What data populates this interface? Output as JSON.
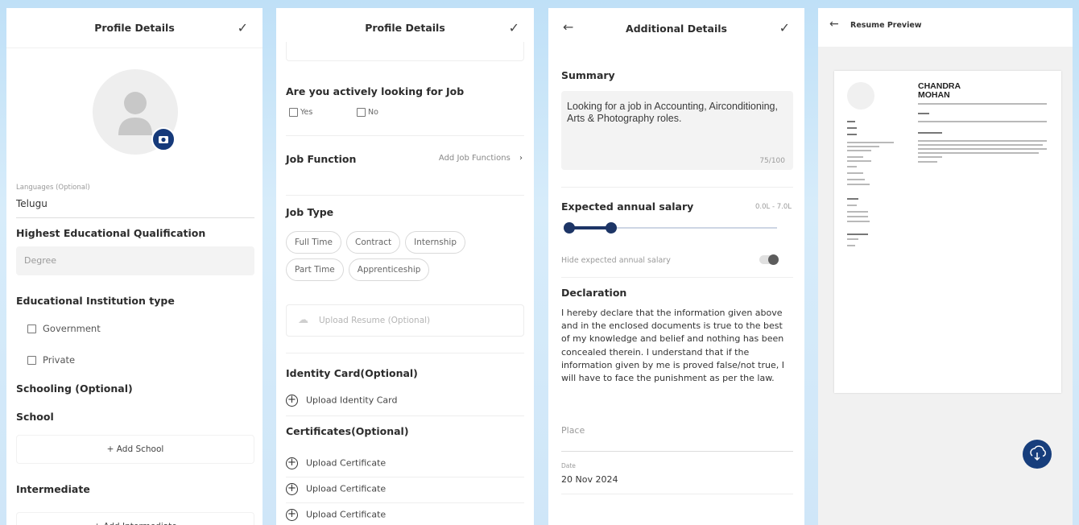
{
  "screen1": {
    "title": "Profile Details",
    "languages_label": "Languages (Optional)",
    "languages_value": "Telugu",
    "qualification_heading": "Highest Educational Qualification",
    "qualification_value": "Degree",
    "institution_heading": "Educational Institution type",
    "institution_options": [
      "Government",
      "Private"
    ],
    "schooling_heading": "Schooling (Optional)",
    "school_heading": "School",
    "add_school": "+ Add School",
    "intermediate_heading": "Intermediate",
    "add_intermediate": "+ Add Intermediate"
  },
  "screen2": {
    "title": "Profile Details",
    "looking_heading": "Are you actively looking for Job",
    "looking_options": [
      "Yes",
      "No"
    ],
    "job_function_heading": "Job Function",
    "job_function_link": "Add Job Functions",
    "job_type_heading": "Job Type",
    "job_types": [
      "Full Time",
      "Contract",
      "Internship",
      "Part Time",
      "Apprenticeship"
    ],
    "upload_resume": "Upload Resume (Optional)",
    "identity_heading": "Identity Card(Optional)",
    "upload_identity": "Upload Identity Card",
    "certificates_heading": "Certificates(Optional)",
    "upload_certificates": [
      "Upload Certificate",
      "Upload Certificate",
      "Upload Certificate"
    ]
  },
  "screen3": {
    "title": "Additional Details",
    "summary_heading": "Summary",
    "summary_text": "Looking for a job in Accounting, Airconditioning, Arts & Photography roles.",
    "summary_count": "75/100",
    "salary_heading": "Expected annual salary",
    "salary_range": "0.0L - 7.0L",
    "salary_slider": {
      "min_fraction": 0.0,
      "max_fraction": 0.2
    },
    "hide_salary_label": "Hide expected annual salary",
    "declaration_heading": "Declaration",
    "declaration_text": "I hereby declare that the information given above and in the enclosed documents is true to the best of my knowledge and belief and nothing has been concealed therein. I understand that if the information given by me is proved false/not true, I will have to face the punishment as per the law.",
    "place_placeholder": "Place",
    "date_label": "Date",
    "date_value": "20 Nov 2024"
  },
  "screen4": {
    "title": "Resume Preview",
    "name_line1": "CHANDRA",
    "name_line2": "MOHAN",
    "download_icon": "download-cloud-icon",
    "accent": "#1c3f74"
  },
  "colors": {
    "slider_active": "#1d3566",
    "camera_badge": "#163a7a",
    "fab": "#173e7c"
  }
}
